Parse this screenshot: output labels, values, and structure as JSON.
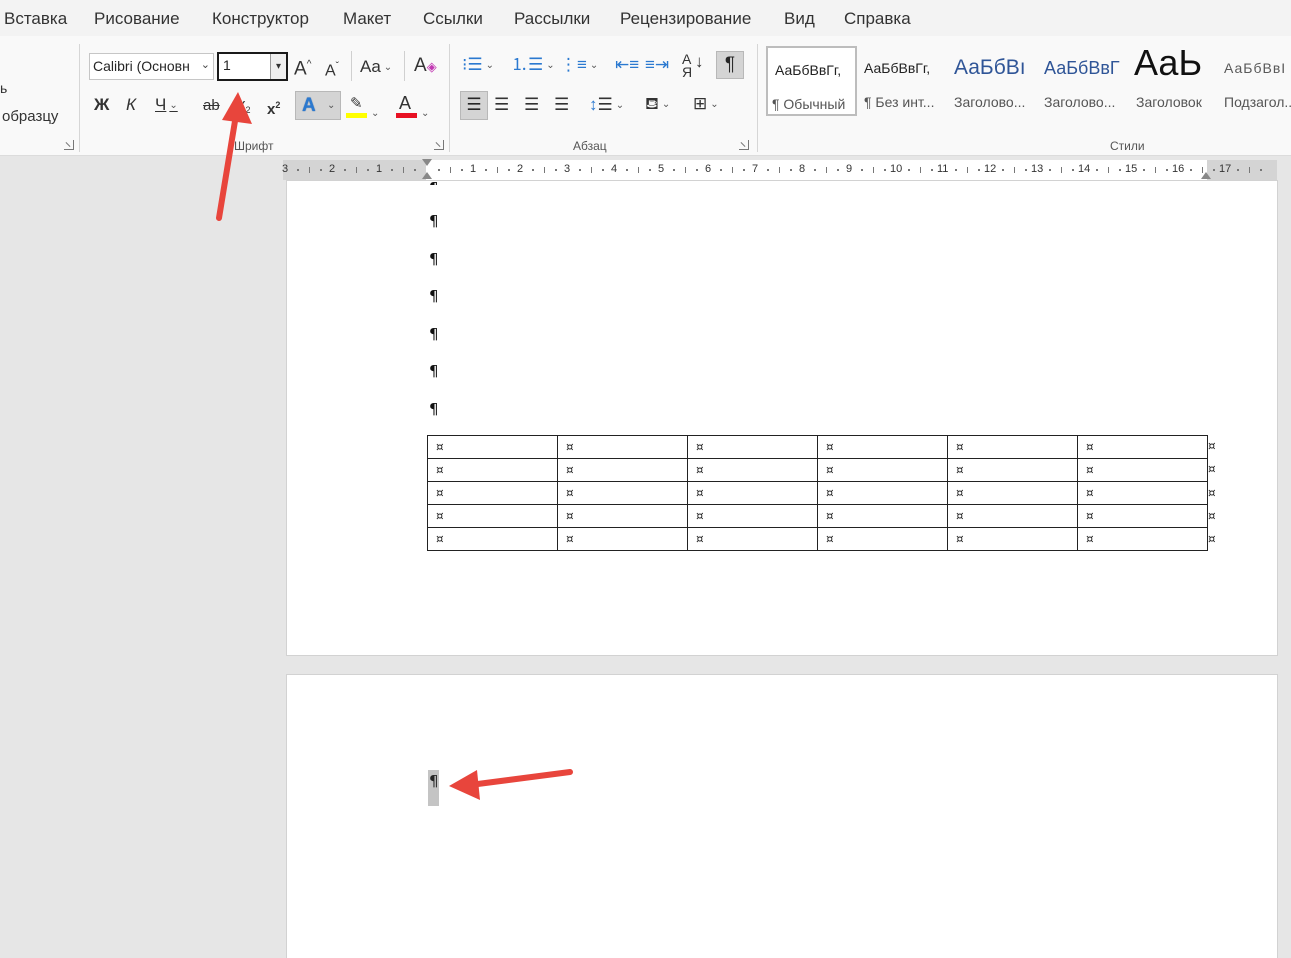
{
  "tabs": [
    "Вставка",
    "Рисование",
    "Конструктор",
    "Макет",
    "Ссылки",
    "Рассылки",
    "Рецензирование",
    "Вид",
    "Справка"
  ],
  "clipboard": {
    "partial_top": "ь",
    "format_painter": "образцу"
  },
  "font": {
    "name": "Calibri (Основн",
    "size": "1",
    "grow": "A",
    "shrink": "A",
    "case": "Aa",
    "bold": "Ж",
    "italic": "К",
    "underline": "Ч",
    "strike": "ab",
    "subscript": "x",
    "superscript": "x",
    "text_effects": "A",
    "font_color": "A",
    "group_label": "Шрифт",
    "highlight_color": "#ffff00",
    "font_color_hex": "#e81123"
  },
  "paragraph": {
    "group_label": "Абзац"
  },
  "styles": {
    "group_label": "Стили",
    "items": [
      {
        "preview": "АаБбВвГг,",
        "name": "¶ Обычный"
      },
      {
        "preview": "АаБбВвГг,",
        "name": "¶ Без инт..."
      },
      {
        "preview": "АаБбВı",
        "name": "Заголово..."
      },
      {
        "preview": "АаБбВвГ",
        "name": "Заголово..."
      },
      {
        "preview": "АаЬ",
        "name": "Заголовок"
      },
      {
        "preview": "АаБбВвІ",
        "name": "Подзагол..."
      }
    ]
  },
  "ruler": {
    "numbers": [
      "3",
      "2",
      "1",
      "1",
      "2",
      "3",
      "4",
      "5",
      "6",
      "7",
      "8",
      "9",
      "10",
      "11",
      "12",
      "13",
      "14",
      "15",
      "16",
      "17"
    ]
  },
  "document": {
    "paragraph_mark": "¶",
    "cell_mark": "¤",
    "table": {
      "rows": [
        [
          "¤",
          "¤",
          "¤",
          "¤",
          "¤",
          "¤"
        ],
        [
          "¤",
          "¤",
          "¤",
          "¤",
          "¤",
          "¤"
        ],
        [
          "¤",
          "¤",
          "¤",
          "¤",
          "¤",
          "¤"
        ],
        [
          "¤",
          "¤",
          "¤",
          "¤",
          "¤",
          "¤"
        ],
        [
          "¤",
          "¤",
          "¤",
          "¤",
          "¤",
          "¤"
        ]
      ]
    }
  },
  "colors": {
    "accent_arrow": "#e8453c",
    "text_effects_blue": "#2b79d0"
  }
}
